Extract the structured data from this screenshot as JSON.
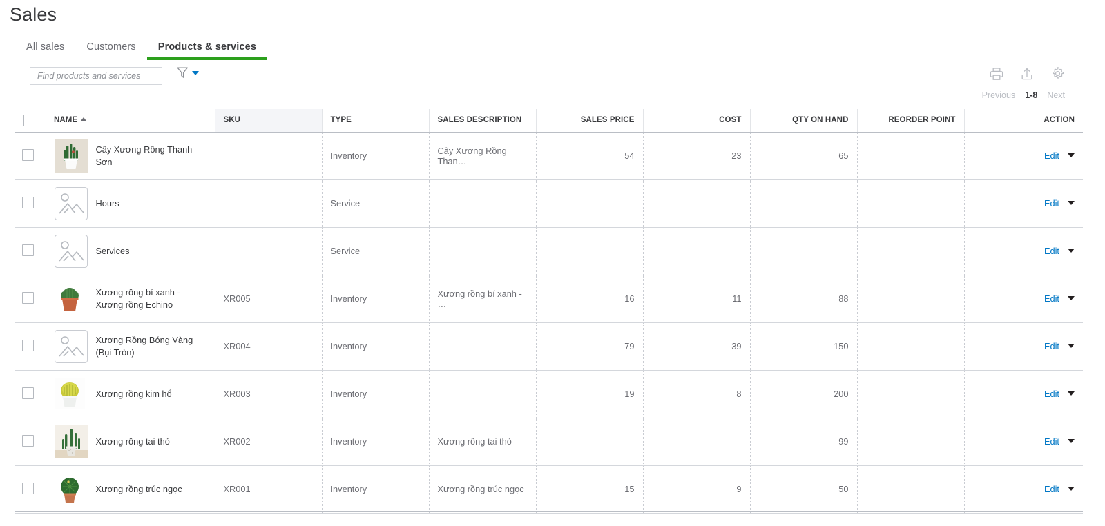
{
  "page": {
    "title": "Sales"
  },
  "tabs": [
    {
      "label": "All sales",
      "active": false
    },
    {
      "label": "Customers",
      "active": false
    },
    {
      "label": "Products & services",
      "active": true
    }
  ],
  "toolbar": {
    "search_placeholder": "Find products and services",
    "search_value": "",
    "filter_icon": "funnel-icon",
    "print_icon": "printer-icon",
    "export_icon": "export-upload-icon",
    "settings_icon": "gear-icon"
  },
  "pagination": {
    "previous_label": "Previous",
    "range_label": "1-8",
    "next_label": "Next"
  },
  "table": {
    "columns": [
      {
        "key": "name",
        "label": "NAME",
        "sorted": "asc"
      },
      {
        "key": "sku",
        "label": "SKU"
      },
      {
        "key": "type",
        "label": "TYPE"
      },
      {
        "key": "sales_description",
        "label": "SALES DESCRIPTION"
      },
      {
        "key": "sales_price",
        "label": "SALES PRICE"
      },
      {
        "key": "cost",
        "label": "COST"
      },
      {
        "key": "qty_on_hand",
        "label": "QTY ON HAND"
      },
      {
        "key": "reorder_point",
        "label": "REORDER POINT"
      },
      {
        "key": "action",
        "label": "ACTION"
      }
    ],
    "action_label": "Edit",
    "rows": [
      {
        "name": "Cây Xương Rồng Thanh Sơn",
        "sku": "",
        "type": "Inventory",
        "sales_description": "Cây Xương Rồng Than…",
        "sales_price": "54",
        "cost": "23",
        "qty_on_hand": "65",
        "reorder_point": "",
        "thumb": "photo-cactus-white-pot-tall"
      },
      {
        "name": "Hours",
        "sku": "",
        "type": "Service",
        "sales_description": "",
        "sales_price": "",
        "cost": "",
        "qty_on_hand": "",
        "reorder_point": "",
        "thumb": "image-placeholder-icon"
      },
      {
        "name": "Services",
        "sku": "",
        "type": "Service",
        "sales_description": "",
        "sales_price": "",
        "cost": "",
        "qty_on_hand": "",
        "reorder_point": "",
        "thumb": "image-placeholder-icon"
      },
      {
        "name": "Xương rồng bí xanh - Xương rồng Echino",
        "sku": "XR005",
        "type": "Inventory",
        "sales_description": "Xương rồng bí xanh - …",
        "sales_price": "16",
        "cost": "11",
        "qty_on_hand": "88",
        "reorder_point": "",
        "thumb": "photo-cactus-terracotta-pot-round"
      },
      {
        "name": "Xương Rồng Bóng Vàng (Bụi Tròn)",
        "sku": "XR004",
        "type": "Inventory",
        "sales_description": "",
        "sales_price": "79",
        "cost": "39",
        "qty_on_hand": "150",
        "reorder_point": "",
        "thumb": "image-placeholder-icon"
      },
      {
        "name": "Xương rồng kim hổ",
        "sku": "XR003",
        "type": "Inventory",
        "sales_description": "",
        "sales_price": "19",
        "cost": "8",
        "qty_on_hand": "200",
        "reorder_point": "",
        "thumb": "photo-golden-barrel-cactus-white-pot"
      },
      {
        "name": "Xương rồng tai thỏ",
        "sku": "XR002",
        "type": "Inventory",
        "sales_description": "Xương rồng tai thỏ",
        "sales_price": "",
        "cost": "",
        "qty_on_hand": "99",
        "reorder_point": "",
        "thumb": "photo-cactus-speckled-pot-branching"
      },
      {
        "name": "Xương rồng trúc ngọc",
        "sku": "XR001",
        "type": "Inventory",
        "sales_description": "Xương rồng trúc ngọc",
        "sales_price": "15",
        "cost": "9",
        "qty_on_hand": "50",
        "reorder_point": "",
        "thumb": "photo-cactus-terracotta-pot-dark-green"
      }
    ]
  },
  "colors": {
    "accent_green": "#2ca01c",
    "link_blue": "#0077c5",
    "text_dark": "#393a3d",
    "text_muted": "#6b6c72"
  }
}
